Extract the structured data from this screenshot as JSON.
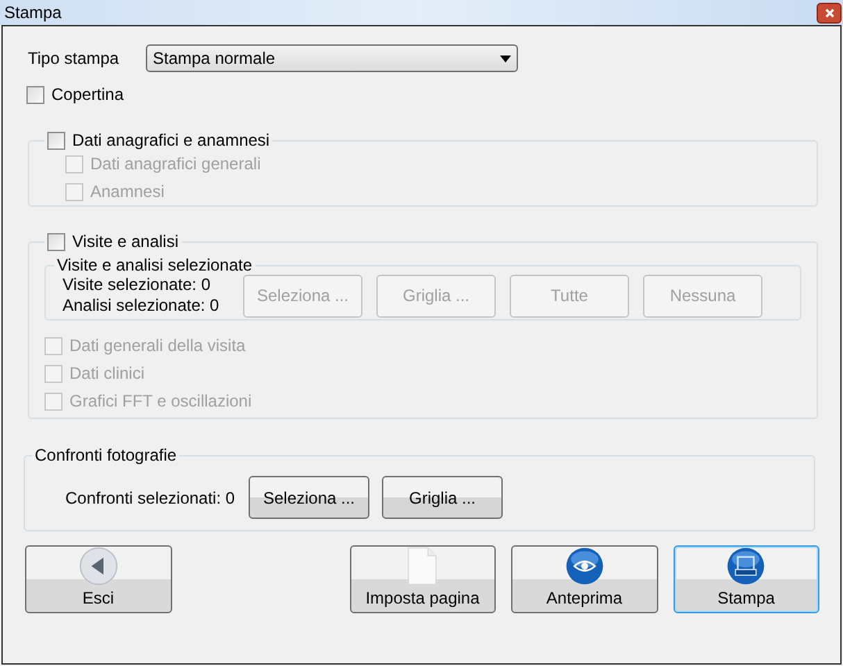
{
  "window": {
    "title": "Stampa"
  },
  "print_type": {
    "label": "Tipo stampa",
    "value": "Stampa normale"
  },
  "cover": {
    "label": "Copertina",
    "checked": false
  },
  "registry_group": {
    "label": "Dati anagrafici e anamnesi",
    "checked": false,
    "items": [
      {
        "label": "Dati anagrafici generali",
        "checked": false,
        "disabled": true
      },
      {
        "label": "Anamnesi",
        "checked": false,
        "disabled": true
      }
    ]
  },
  "visits_group": {
    "label": "Visite e analisi",
    "checked": false,
    "selection": {
      "title": "Visite e analisi selezionate",
      "lines": [
        "Visite selezionate: 0",
        "Analisi selezionate: 0"
      ],
      "buttons": [
        {
          "label": "Seleziona ...",
          "disabled": true
        },
        {
          "label": "Griglia ...",
          "disabled": true
        },
        {
          "label": "Tutte",
          "disabled": true
        },
        {
          "label": "Nessuna",
          "disabled": true
        }
      ]
    },
    "items": [
      {
        "label": "Dati generali della visita",
        "checked": false,
        "disabled": true
      },
      {
        "label": "Dati clinici",
        "checked": false,
        "disabled": true
      },
      {
        "label": "Grafici FFT e oscillazioni",
        "checked": false,
        "disabled": true
      }
    ]
  },
  "photo_compare": {
    "title": "Confronti fotografie",
    "count": "Confronti selezionati: 0",
    "buttons": [
      {
        "label": "Seleziona ...",
        "disabled": false
      },
      {
        "label": "Griglia ...",
        "disabled": false
      }
    ]
  },
  "footer_buttons": [
    {
      "label": "Esci",
      "kind": "back",
      "focused": false
    },
    {
      "label": "Imposta pagina",
      "kind": "page",
      "focused": false
    },
    {
      "label": "Anteprima",
      "kind": "preview",
      "focused": false
    },
    {
      "label": "Stampa",
      "kind": "print",
      "focused": true
    }
  ]
}
